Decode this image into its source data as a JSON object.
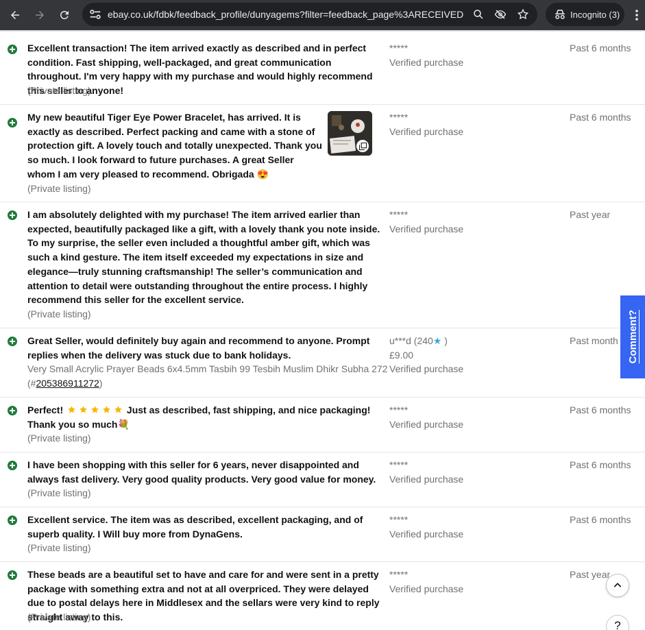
{
  "browser": {
    "url_host": "ebay.co.uk",
    "url_path": "/fdbk/feedback_profile/dunyagems?filter=feedback_page%3ARECEIVED...",
    "incognito_label": "Incognito (3)"
  },
  "feedback": [
    {
      "comment": "Excellent transaction! The item arrived exactly as described and in perfect condition. Fast shipping, well-packaged, and great communication throughout. I'm very happy with my purchase and would highly recommend this seller to anyone!",
      "listing": "(Private listing)",
      "user": "*****",
      "verified": "Verified purchase",
      "time": "Past 6 months"
    },
    {
      "comment": "My new beautiful Tiger Eye Power Bracelet, has arrived. It is exactly as described. Perfect packing and came with a stone of protection gift. A lovely touch and totally unexpected. Thank you so much. I look forward to future purchases. A great Seller whom I am very pleased to recommend. Obrigada 😍",
      "listing": "(Private listing)",
      "user": "*****",
      "verified": "Verified purchase",
      "time": "Past 6 months"
    },
    {
      "comment": "I am absolutely delighted with my purchase! The item arrived earlier than expected, beautifully packaged like a gift, with a lovely thank you note inside. To my surprise, the seller even included a thoughtful amber gift, which was such a kind gesture. The item itself exceeded my expectations in size and elegance—truly stunning craftsmanship! The seller’s communication and attention to detail were outstanding throughout the entire process. I highly recommend this seller for the excellent service.",
      "listing": "(Private listing)",
      "user": "*****",
      "verified": "Verified purchase",
      "time": "Past year"
    },
    {
      "comment": "Great Seller, would definitely buy again and recommend to anyone. Prompt replies when the delivery was stuck due to bank holidays.",
      "listing_title": "Very Small Acrylic Prayer Beads 6x4.5mm Tasbih 99 Tesbih Muslim Dhikr Subha 272",
      "listing_prefix": "(#",
      "listing_id": "205386911272",
      "listing_suffix": ")",
      "user_name": "u***d (240",
      "user_star": "★",
      "user_close": " )",
      "price": "£9.00",
      "verified": "Verified purchase",
      "time": "Past month"
    },
    {
      "comment_start": "Perfect!",
      "comment_end": "Just as described, fast shipping, and nice packaging! Thank you so much💐",
      "listing": "(Private listing)",
      "user": "*****",
      "verified": "Verified purchase",
      "time": "Past 6 months"
    },
    {
      "comment": "I have been shopping with this seller for 6 years, never disappointed and always fast delivery. Very good quality products. Very good value for money.",
      "listing": "(Private listing)",
      "user": "*****",
      "verified": "Verified purchase",
      "time": "Past 6 months"
    },
    {
      "comment": "Excellent service. The item was as described, excellent packaging, and of superb quality. I Will buy more from DynaGens.",
      "listing": "(Private listing)",
      "user": "*****",
      "verified": "Verified purchase",
      "time": "Past 6 months"
    },
    {
      "comment": "These beads are a beautiful set to have and care for and were sent in a pretty package with something extra and not at all overpriced. They were delayed due to postal delays here in Middlesex and the sellars were very kind to reply straight away to this.",
      "listing": "(Private listing)",
      "user": "*****",
      "verified": "Verified purchase",
      "time": "Past year"
    }
  ],
  "comment_tab_label": "Comment?",
  "help_label": "?",
  "colors": {
    "chrome_bg": "#35363a",
    "positive_icon": "#1f7a3a",
    "comment_tab": "#3665f3",
    "muted_text": "#707070"
  }
}
